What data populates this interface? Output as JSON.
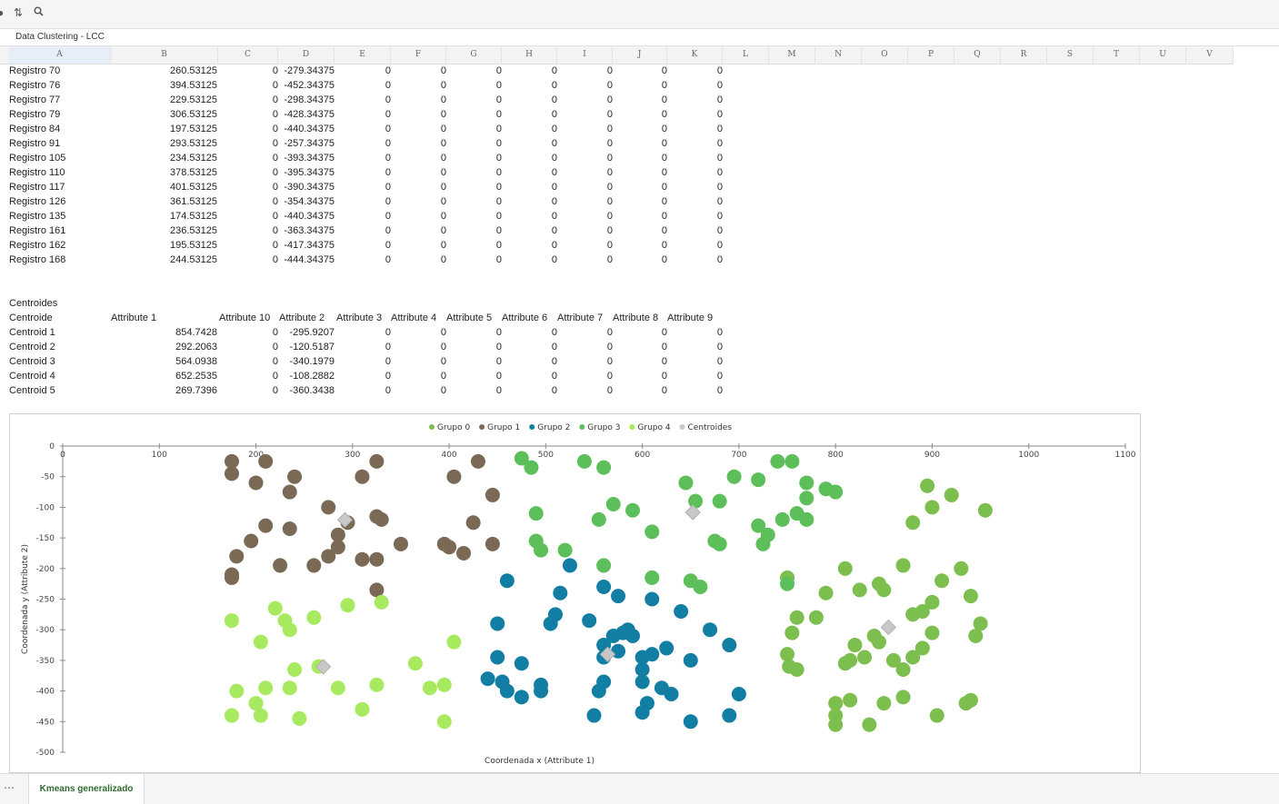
{
  "toolbar": {
    "icons": [
      "sort-icon",
      "search-icon"
    ]
  },
  "namebar": {
    "title": "Data Clustering - LCC"
  },
  "columns": [
    "A",
    "B",
    "C",
    "D",
    "E",
    "F",
    "G",
    "H",
    "I",
    "J",
    "K",
    "L",
    "M",
    "N",
    "O",
    "P",
    "Q",
    "R",
    "S",
    "T",
    "U",
    "V"
  ],
  "registros": [
    [
      "Registro 70",
      "260.53125",
      "0",
      "-279.34375",
      "0",
      "0",
      "0",
      "0",
      "0",
      "0",
      "0"
    ],
    [
      "Registro 76",
      "394.53125",
      "0",
      "-452.34375",
      "0",
      "0",
      "0",
      "0",
      "0",
      "0",
      "0"
    ],
    [
      "Registro 77",
      "229.53125",
      "0",
      "-298.34375",
      "0",
      "0",
      "0",
      "0",
      "0",
      "0",
      "0"
    ],
    [
      "Registro 79",
      "306.53125",
      "0",
      "-428.34375",
      "0",
      "0",
      "0",
      "0",
      "0",
      "0",
      "0"
    ],
    [
      "Registro 84",
      "197.53125",
      "0",
      "-440.34375",
      "0",
      "0",
      "0",
      "0",
      "0",
      "0",
      "0"
    ],
    [
      "Registro 91",
      "293.53125",
      "0",
      "-257.34375",
      "0",
      "0",
      "0",
      "0",
      "0",
      "0",
      "0"
    ],
    [
      "Registro 105",
      "234.53125",
      "0",
      "-393.34375",
      "0",
      "0",
      "0",
      "0",
      "0",
      "0",
      "0"
    ],
    [
      "Registro 110",
      "378.53125",
      "0",
      "-395.34375",
      "0",
      "0",
      "0",
      "0",
      "0",
      "0",
      "0"
    ],
    [
      "Registro 117",
      "401.53125",
      "0",
      "-390.34375",
      "0",
      "0",
      "0",
      "0",
      "0",
      "0",
      "0"
    ],
    [
      "Registro 126",
      "361.53125",
      "0",
      "-354.34375",
      "0",
      "0",
      "0",
      "0",
      "0",
      "0",
      "0"
    ],
    [
      "Registro 135",
      "174.53125",
      "0",
      "-440.34375",
      "0",
      "0",
      "0",
      "0",
      "0",
      "0",
      "0"
    ],
    [
      "Registro 161",
      "236.53125",
      "0",
      "-363.34375",
      "0",
      "0",
      "0",
      "0",
      "0",
      "0",
      "0"
    ],
    [
      "Registro 162",
      "195.53125",
      "0",
      "-417.34375",
      "0",
      "0",
      "0",
      "0",
      "0",
      "0",
      "0"
    ],
    [
      "Registro 168",
      "244.53125",
      "0",
      "-444.34375",
      "0",
      "0",
      "0",
      "0",
      "0",
      "0",
      "0"
    ]
  ],
  "centroides_label": "Centroides",
  "centroid_header": [
    "Centroide",
    "Attribute 1",
    "Attribute 10",
    "Attribute 2",
    "Attribute 3",
    "Attribute 4",
    "Attribute 5",
    "Attribute 6",
    "Attribute 7",
    "Attribute 8",
    "Attribute 9"
  ],
  "centroids": [
    [
      "Centroid 1",
      "854.7428",
      "0",
      "-295.9207",
      "0",
      "0",
      "0",
      "0",
      "0",
      "0",
      "0"
    ],
    [
      "Centroid 2",
      "292.2063",
      "0",
      "-120.5187",
      "0",
      "0",
      "0",
      "0",
      "0",
      "0",
      "0"
    ],
    [
      "Centroid 3",
      "564.0938",
      "0",
      "-340.1979",
      "0",
      "0",
      "0",
      "0",
      "0",
      "0",
      "0"
    ],
    [
      "Centroid 4",
      "652.2535",
      "0",
      "-108.2882",
      "0",
      "0",
      "0",
      "0",
      "0",
      "0",
      "0"
    ],
    [
      "Centroid 5",
      "269.7396",
      "0",
      "-360.3438",
      "0",
      "0",
      "0",
      "0",
      "0",
      "0",
      "0"
    ]
  ],
  "sheet_tab": "Kmeans generalizado",
  "chart_data": {
    "type": "scatter",
    "xlabel": "Coordenada x (Attribute 1)",
    "ylabel": "Coordenada y (Attribute 2)",
    "xlim": [
      0,
      1100
    ],
    "ylim": [
      -500,
      0
    ],
    "x_ticks": [
      0,
      100,
      200,
      300,
      400,
      500,
      600,
      700,
      800,
      900,
      1000,
      1100
    ],
    "y_ticks": [
      0,
      -50,
      -100,
      -150,
      -200,
      -250,
      -300,
      -350,
      -400,
      -450,
      -500
    ],
    "legend_position": "top",
    "series": [
      {
        "name": "Grupo 0",
        "color": "#7cbf4e",
        "points": [
          [
            750,
            -215
          ],
          [
            790,
            -240
          ],
          [
            810,
            -200
          ],
          [
            825,
            -235
          ],
          [
            845,
            -225
          ],
          [
            850,
            -235
          ],
          [
            870,
            -195
          ],
          [
            880,
            -275
          ],
          [
            890,
            -270
          ],
          [
            900,
            -255
          ],
          [
            910,
            -220
          ],
          [
            940,
            -245
          ],
          [
            950,
            -290
          ],
          [
            930,
            -200
          ],
          [
            760,
            -280
          ],
          [
            780,
            -280
          ],
          [
            755,
            -305
          ],
          [
            750,
            -340
          ],
          [
            752,
            -360
          ],
          [
            760,
            -365
          ],
          [
            820,
            -325
          ],
          [
            830,
            -345
          ],
          [
            840,
            -310
          ],
          [
            845,
            -320
          ],
          [
            860,
            -350
          ],
          [
            870,
            -365
          ],
          [
            880,
            -345
          ],
          [
            890,
            -330
          ],
          [
            900,
            -305
          ],
          [
            810,
            -355
          ],
          [
            815,
            -350
          ],
          [
            800,
            -420
          ],
          [
            815,
            -415
          ],
          [
            800,
            -440
          ],
          [
            800,
            -455
          ],
          [
            835,
            -455
          ],
          [
            850,
            -420
          ],
          [
            870,
            -410
          ],
          [
            905,
            -440
          ],
          [
            935,
            -420
          ],
          [
            940,
            -415
          ],
          [
            945,
            -310
          ],
          [
            880,
            -125
          ],
          [
            900,
            -100
          ],
          [
            920,
            -80
          ],
          [
            895,
            -65
          ],
          [
            955,
            -105
          ]
        ]
      },
      {
        "name": "Grupo 1",
        "color": "#7a6a55",
        "points": [
          [
            175,
            -25
          ],
          [
            210,
            -25
          ],
          [
            240,
            -50
          ],
          [
            235,
            -75
          ],
          [
            200,
            -60
          ],
          [
            175,
            -45
          ],
          [
            180,
            -180
          ],
          [
            195,
            -155
          ],
          [
            210,
            -130
          ],
          [
            235,
            -135
          ],
          [
            175,
            -210
          ],
          [
            175,
            -215
          ],
          [
            225,
            -195
          ],
          [
            260,
            -195
          ],
          [
            275,
            -100
          ],
          [
            285,
            -145
          ],
          [
            285,
            -165
          ],
          [
            275,
            -180
          ],
          [
            295,
            -125
          ],
          [
            310,
            -185
          ],
          [
            325,
            -115
          ],
          [
            330,
            -120
          ],
          [
            325,
            -185
          ],
          [
            350,
            -160
          ],
          [
            310,
            -50
          ],
          [
            325,
            -25
          ],
          [
            325,
            -235
          ],
          [
            395,
            -160
          ],
          [
            400,
            -165
          ],
          [
            415,
            -175
          ],
          [
            405,
            -50
          ],
          [
            425,
            -125
          ],
          [
            430,
            -25
          ],
          [
            445,
            -80
          ],
          [
            445,
            -160
          ]
        ]
      },
      {
        "name": "Grupo 2",
        "color": "#127ea3",
        "points": [
          [
            460,
            -220
          ],
          [
            450,
            -290
          ],
          [
            525,
            -195
          ],
          [
            515,
            -240
          ],
          [
            545,
            -285
          ],
          [
            560,
            -230
          ],
          [
            575,
            -245
          ],
          [
            610,
            -250
          ],
          [
            640,
            -270
          ],
          [
            670,
            -300
          ],
          [
            690,
            -325
          ],
          [
            560,
            -325
          ],
          [
            570,
            -310
          ],
          [
            580,
            -305
          ],
          [
            585,
            -300
          ],
          [
            590,
            -310
          ],
          [
            575,
            -335
          ],
          [
            560,
            -345
          ],
          [
            600,
            -345
          ],
          [
            610,
            -340
          ],
          [
            625,
            -330
          ],
          [
            650,
            -350
          ],
          [
            560,
            -385
          ],
          [
            555,
            -400
          ],
          [
            600,
            -365
          ],
          [
            600,
            -385
          ],
          [
            620,
            -395
          ],
          [
            630,
            -405
          ],
          [
            650,
            -450
          ],
          [
            690,
            -440
          ],
          [
            700,
            -405
          ],
          [
            600,
            -435
          ],
          [
            605,
            -420
          ],
          [
            550,
            -440
          ],
          [
            505,
            -290
          ],
          [
            510,
            -275
          ],
          [
            450,
            -345
          ],
          [
            455,
            -385
          ],
          [
            440,
            -380
          ],
          [
            475,
            -355
          ],
          [
            495,
            -390
          ],
          [
            495,
            -400
          ],
          [
            460,
            -400
          ],
          [
            475,
            -410
          ]
        ]
      },
      {
        "name": "Grupo 3",
        "color": "#5cbf5a",
        "points": [
          [
            475,
            -20
          ],
          [
            485,
            -35
          ],
          [
            540,
            -25
          ],
          [
            560,
            -35
          ],
          [
            590,
            -105
          ],
          [
            555,
            -120
          ],
          [
            570,
            -95
          ],
          [
            610,
            -140
          ],
          [
            645,
            -60
          ],
          [
            655,
            -90
          ],
          [
            680,
            -90
          ],
          [
            695,
            -50
          ],
          [
            720,
            -55
          ],
          [
            740,
            -25
          ],
          [
            755,
            -25
          ],
          [
            720,
            -130
          ],
          [
            730,
            -145
          ],
          [
            725,
            -160
          ],
          [
            745,
            -120
          ],
          [
            760,
            -110
          ],
          [
            770,
            -85
          ],
          [
            770,
            -60
          ],
          [
            770,
            -120
          ],
          [
            800,
            -75
          ],
          [
            790,
            -70
          ],
          [
            675,
            -155
          ],
          [
            680,
            -160
          ],
          [
            490,
            -110
          ],
          [
            490,
            -155
          ],
          [
            495,
            -170
          ],
          [
            520,
            -170
          ],
          [
            560,
            -195
          ],
          [
            610,
            -215
          ],
          [
            650,
            -220
          ],
          [
            660,
            -230
          ],
          [
            750,
            -225
          ]
        ]
      },
      {
        "name": "Grupo 4",
        "color": "#a8ea5f",
        "points": [
          [
            175,
            -285
          ],
          [
            220,
            -265
          ],
          [
            230,
            -285
          ],
          [
            235,
            -300
          ],
          [
            205,
            -320
          ],
          [
            260,
            -280
          ],
          [
            295,
            -260
          ],
          [
            330,
            -255
          ],
          [
            175,
            -440
          ],
          [
            200,
            -420
          ],
          [
            205,
            -440
          ],
          [
            180,
            -400
          ],
          [
            210,
            -395
          ],
          [
            240,
            -365
          ],
          [
            235,
            -395
          ],
          [
            245,
            -445
          ],
          [
            265,
            -360
          ],
          [
            285,
            -395
          ],
          [
            310,
            -430
          ],
          [
            325,
            -390
          ],
          [
            365,
            -355
          ],
          [
            380,
            -395
          ],
          [
            405,
            -320
          ],
          [
            395,
            -390
          ],
          [
            395,
            -450
          ]
        ]
      },
      {
        "name": "Centroides",
        "color": "#c8c8c8",
        "marker": "diamond",
        "points": [
          [
            854.7428,
            -295.9207
          ],
          [
            292.2063,
            -120.5187
          ],
          [
            564.0938,
            -340.1979
          ],
          [
            652.2535,
            -108.2882
          ],
          [
            269.7396,
            -360.3438
          ]
        ]
      }
    ]
  }
}
